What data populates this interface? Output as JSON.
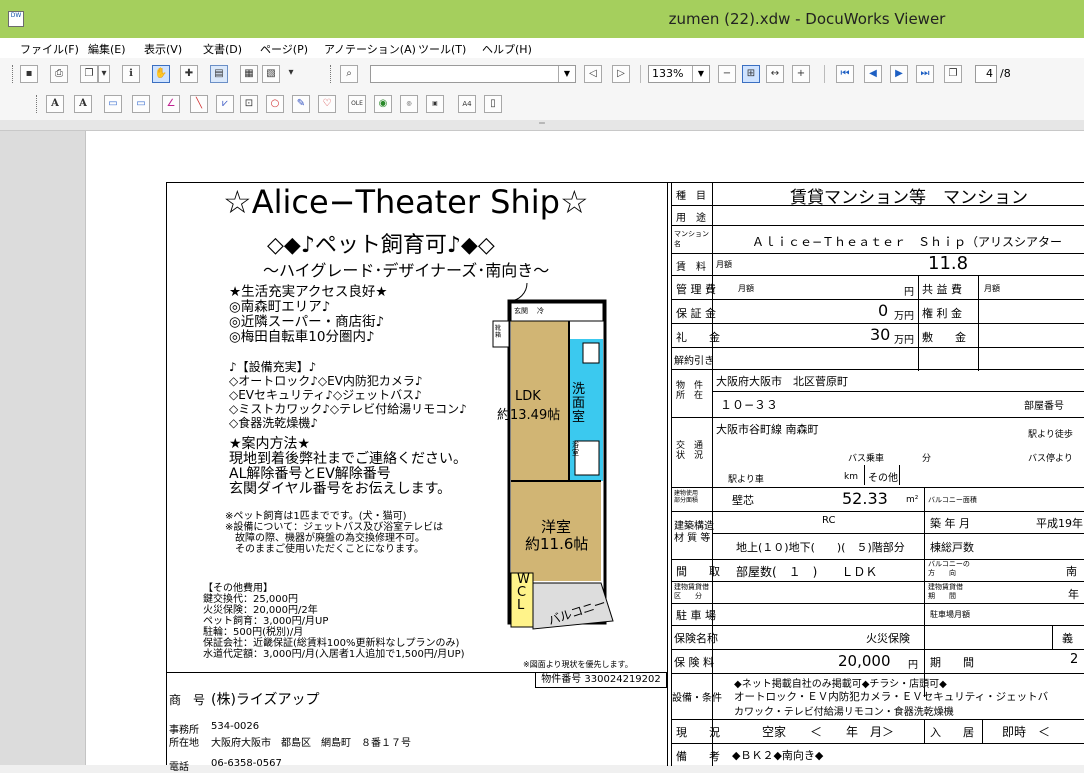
{
  "window": {
    "title": "zumen (22).xdw - DocuWorks Viewer",
    "app_icon": "DW"
  },
  "menu": [
    "ファイル(F)",
    "編集(E)",
    "表示(V)",
    "文書(D)",
    "ページ(P)",
    "アノテーション(A)",
    "ツール(T)",
    "ヘルプ(H)"
  ],
  "toolbar": {
    "zoom": "133%",
    "page_current": "4",
    "page_total": "/8",
    "search_value": "",
    "text_a1": "A",
    "text_a2": "A"
  },
  "doc": {
    "title": "☆Alice−Theater Ship☆",
    "subtitle": "◇◆♪ペット飼育可♪◆◇",
    "subtitle2": "～ハイグレード･デザイナーズ･南向き～",
    "features1": [
      "★生活充実アクセス良好★",
      "◎南森町エリア♪",
      "◎近隣スーパー・商店街♪",
      "◎梅田自転車10分圏内♪"
    ],
    "features2": [
      "♪【設備充実】♪",
      "◇オートロック♪◇EV内防犯カメラ♪",
      "◇EVセキュリティ♪◇ジェットバス♪",
      "◇ミストカワック♪◇テレビ付給湯リモコン♪",
      "◇食器洗乾燥機♪"
    ],
    "guide": [
      "★案内方法★",
      "現地到着後弊社までご連絡ください。",
      "AL解除番号とEV解除番号",
      "玄関ダイヤル番号をお伝えします。"
    ],
    "notes": [
      "※ペット飼育は1匹までです。(犬・猫可)",
      "※設備について：ジェットバス及び浴室テレビは",
      "　故障の際、機器が廃盤の為交換修理不可。",
      "　そのままご使用いただくことになります。"
    ],
    "costs": [
      "【その他費用】",
      "鍵交換代：25,000円",
      "火災保険：20,000円/2年",
      "ペット飼育：3,000円/月UP",
      "駐輪：500円(税別)/月",
      "保証会社：近畿保証(総賃料100%更新料なしプランのみ)",
      "水道代定額：3,000円/月(入居者1人追加で1,500円/月UP)"
    ],
    "floor_labels": {
      "ldk": "LDK",
      "ldk_size": "約13.49帖",
      "yoshitsu": "洋室",
      "yoshitsu_size": "約11.6帖",
      "senmen": "洗面室",
      "wcl": "WCL",
      "balcony": "バルコニー",
      "genkan": "玄関",
      "reizo": "冷",
      "getabako": "靴箱",
      "yoku": "浴室"
    },
    "note_priority": "※図面より現状を優先します。",
    "property_no": "物件番号 330024219202",
    "company_label": "商　号",
    "company": "(株)ライズアップ",
    "office_label": "事務所",
    "office_zip": "534-0026",
    "address_label": "所在地",
    "address": "大阪府大阪市　都島区　網島町　８番１７号",
    "tel_label": "電話",
    "tel": "06-6358-0567"
  },
  "sheet": {
    "type_label": "種　目",
    "type_value": "賃貸マンション等　マンション",
    "use_label": "用　途",
    "name_label": "マンション名",
    "name_value": "Ａｌｉｃｅ−Ｔｈｅａｔｅｒ　Ｓｈｉｐ（アリスシアター",
    "rent_label": "賃　料",
    "rent_unit": "月額",
    "rent_value": "11.8",
    "mgmt_label": "管 理 費",
    "mgmt_unit": "月額",
    "mgmt_yen": "円",
    "common_label": "共 益 費",
    "common_unit": "月額",
    "deposit_label": "保 証 金",
    "deposit_value": "0",
    "deposit_unit": "万円",
    "key_label": "権 利 金",
    "gift_label": "礼　　金",
    "gift_value": "30",
    "gift_unit": "万円",
    "shiki_label": "敷　　金",
    "cancel_label": "解約引き",
    "loc_label": "物　件\n所　在",
    "loc1": "大阪府大阪市　北区菅原町",
    "loc2": "１０−３３",
    "room_label": "部屋番号",
    "traffic_label": "交　通\n状　況",
    "line": "大阪市谷町線 南森町",
    "walk": "駅より徒歩",
    "bus": "バス乗車",
    "min": "分",
    "bus_stop": "バス停より",
    "station_car": "駅より車",
    "km": "km",
    "other": "その他",
    "area_label": "建物使用\n部分面積",
    "area_type": "壁芯",
    "area_value": "52.33",
    "area_unit": "m²",
    "balcony_area": "バルコニー面積",
    "struct_label": "建築構造\n材 質 等",
    "struct_value": "RC",
    "built_label": "築 年 月",
    "built_value": "平成19年",
    "floors": "地上(１０)地下(　　)(　５)階部分",
    "total_units": "棟総戸数",
    "layout_label": "間　　取",
    "rooms": "部屋数(　１　)　　ＬＤＫ",
    "balcony_dir_label": "バルコニーの\n方　　向",
    "balcony_dir": "南",
    "lease_type": "建物賃貸借\n区　　分",
    "lease_period": "建物賃貸借\n期　　間",
    "lease_year": "年",
    "parking_label": "駐 車 場",
    "parking_fee": "駐車場月額",
    "insurance_label": "保険名称",
    "insurance_value": "火災保険",
    "insurance_duty": "義",
    "premium_label": "保 険 料",
    "premium_value": "20,000",
    "premium_unit": "円",
    "period_label": "期　　間",
    "period_value": "2",
    "equip_label": "設備・条件",
    "equip1": "◆ネット掲載自社のみ掲載可◆チラシ・店頭可◆",
    "equip2": "オートロック・ＥＶ内防犯カメラ・ＥＶセキュリティ・ジェットバ",
    "equip3": "カワック・テレビ付給湯リモコン・食器洗乾燥機",
    "status_label": "現　　況",
    "status_value": "空家　　＜　　年　月＞",
    "move_label": "入　　居",
    "move_value": "即時　＜",
    "remarks_label": "備　　考",
    "remarks": "◆ＢＫ２◆南向き◆"
  }
}
